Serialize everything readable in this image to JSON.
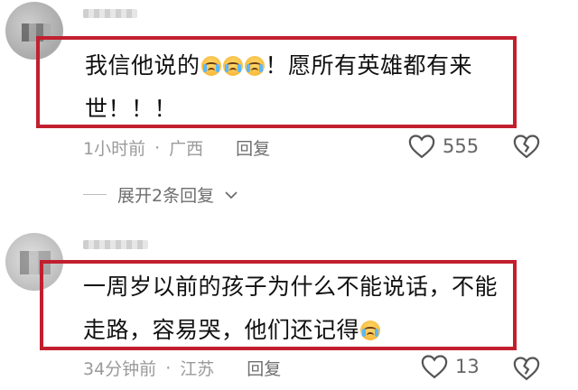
{
  "comments": [
    {
      "text_before": "我信他说的",
      "emoji_name": "crying-face-emoji",
      "emoji_count": 3,
      "text_after": "！愿所有英雄都有来世！！！",
      "time": "1小时前",
      "separator": "·",
      "location": "广西",
      "reply_label": "回复",
      "likes": "555",
      "expand_label": "展开2条回复"
    },
    {
      "text_before": "一周岁以前的孩子为什么不能说话，不能走路，容易哭，他们还记得",
      "emoji_name": "crying-face-emoji",
      "emoji_count": 1,
      "text_after": "",
      "time": "34分钟前",
      "separator": "·",
      "location": "江苏",
      "reply_label": "回复",
      "likes": "13"
    }
  ],
  "colors": {
    "highlight_box": "#c21f2e",
    "meta_text": "#9a9a9a"
  },
  "icons": {
    "like": "heart-outline-icon",
    "dislike": "broken-heart-icon",
    "expand": "chevron-down-icon"
  }
}
